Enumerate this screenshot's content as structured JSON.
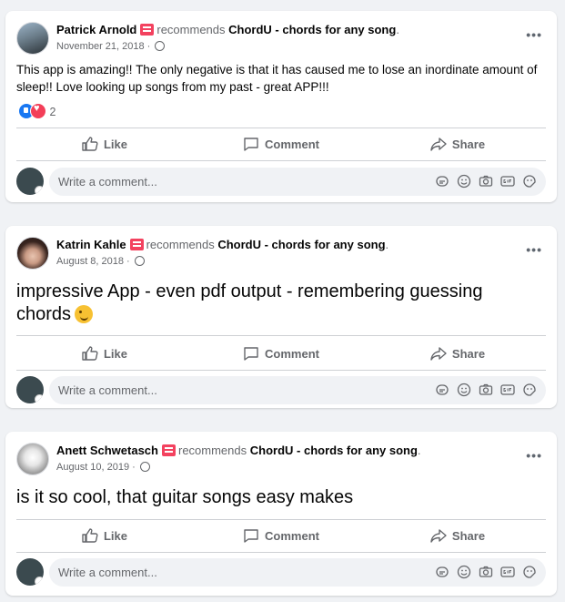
{
  "posts": [
    {
      "author": "Patrick Arnold",
      "recommends_text": "recommends",
      "page": "ChordU - chords for any song",
      "date": "November 21, 2018 ·",
      "text": "This app is amazing!! The only negative is that it has caused me to lose an inordinate amount of sleep!! Love looking up songs from my past - great APP!!!",
      "reaction_count": "2",
      "actions": {
        "like": "Like",
        "comment": "Comment",
        "share": "Share"
      },
      "comment_placeholder": "Write a comment..."
    },
    {
      "author": "Katrin Kahle",
      "recommends_text": "recommends",
      "page": "ChordU - chords for any song",
      "date": "August 8, 2018 ·",
      "text": "impressive App - even pdf output - remembering guessing chords",
      "actions": {
        "like": "Like",
        "comment": "Comment",
        "share": "Share"
      },
      "comment_placeholder": "Write a comment..."
    },
    {
      "author": "Anett Schwetasch",
      "recommends_text": "recommends",
      "page": "ChordU - chords for any song",
      "date": "August 10, 2019 ·",
      "text": "is it so cool, that guitar songs easy makes",
      "actions": {
        "like": "Like",
        "comment": "Comment",
        "share": "Share"
      },
      "comment_placeholder": "Write a comment..."
    }
  ],
  "more_icon_glyph": "•••",
  "icons": [
    "globe-icon",
    "more-icon",
    "like-icon",
    "comment-icon",
    "share-icon",
    "sticker-icon",
    "emoji-icon",
    "camera-icon",
    "gif-icon",
    "sticker-face-icon"
  ],
  "colors": {
    "background": "#f0f2f5",
    "card": "#ffffff",
    "muted": "#65676b",
    "like_blue": "#1877f2",
    "love_red": "#f33e58",
    "recommend_red": "#f3425f"
  }
}
